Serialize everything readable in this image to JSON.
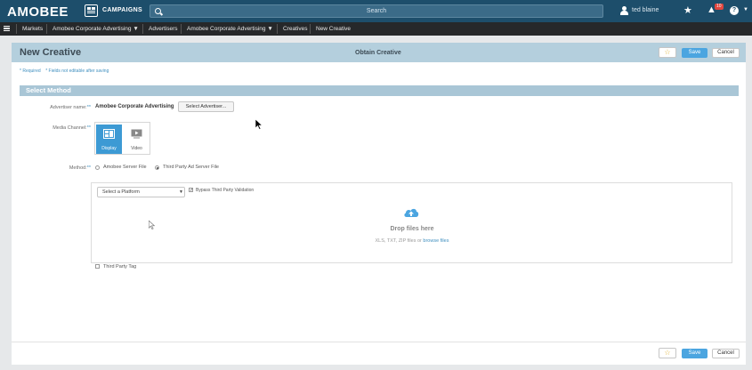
{
  "topbar": {
    "logo": "AMOBEE",
    "campaigns_label": "CAMPAIGNS",
    "search_placeholder": "Search",
    "user_name": "ted blaine",
    "notification_count": "10"
  },
  "nav": {
    "items": [
      "Markets",
      "Amobee Corporate Advertising ▼",
      "Advertisers",
      "Amobee Corporate Advertising ▼",
      "Creatives",
      "New Creative"
    ]
  },
  "page": {
    "title": "New Creative",
    "subtitle": "Obtain Creative",
    "save_label": "Save",
    "cancel_label": "Cancel",
    "notes": {
      "required": "* Required",
      "not_editable": "* Fields not editable after saving"
    }
  },
  "section": {
    "title": "Select Method",
    "advertiser_label": "Advertiser name:",
    "advertiser_value": "Amobee Corporate Advertising",
    "select_advertiser_label": "Select Advertiser...",
    "media_channel_label": "Media Channel:",
    "media_options": [
      "Display",
      "Video"
    ],
    "media_selected": "Display",
    "method_label": "Method:",
    "method_options": [
      "Amobee Server File",
      "Third Party Ad Server File"
    ],
    "method_selected": "Third Party Ad Server File"
  },
  "upload": {
    "platform_placeholder": "Select a Platform",
    "bypass_label": "Bypass Third Party Validation",
    "bypass_checked": true,
    "drop_title": "Drop files here",
    "drop_types": "XLS, TXT, ZIP files or",
    "browse_label": "browse files"
  },
  "third_party_tag_label": "Third Party Tag",
  "colors": {
    "topbar": "#1d4e6b",
    "navbar": "#26282a",
    "accent": "#4ba5e0",
    "header_band": "#b4cfdd",
    "section_bar": "#a9c6d6"
  }
}
